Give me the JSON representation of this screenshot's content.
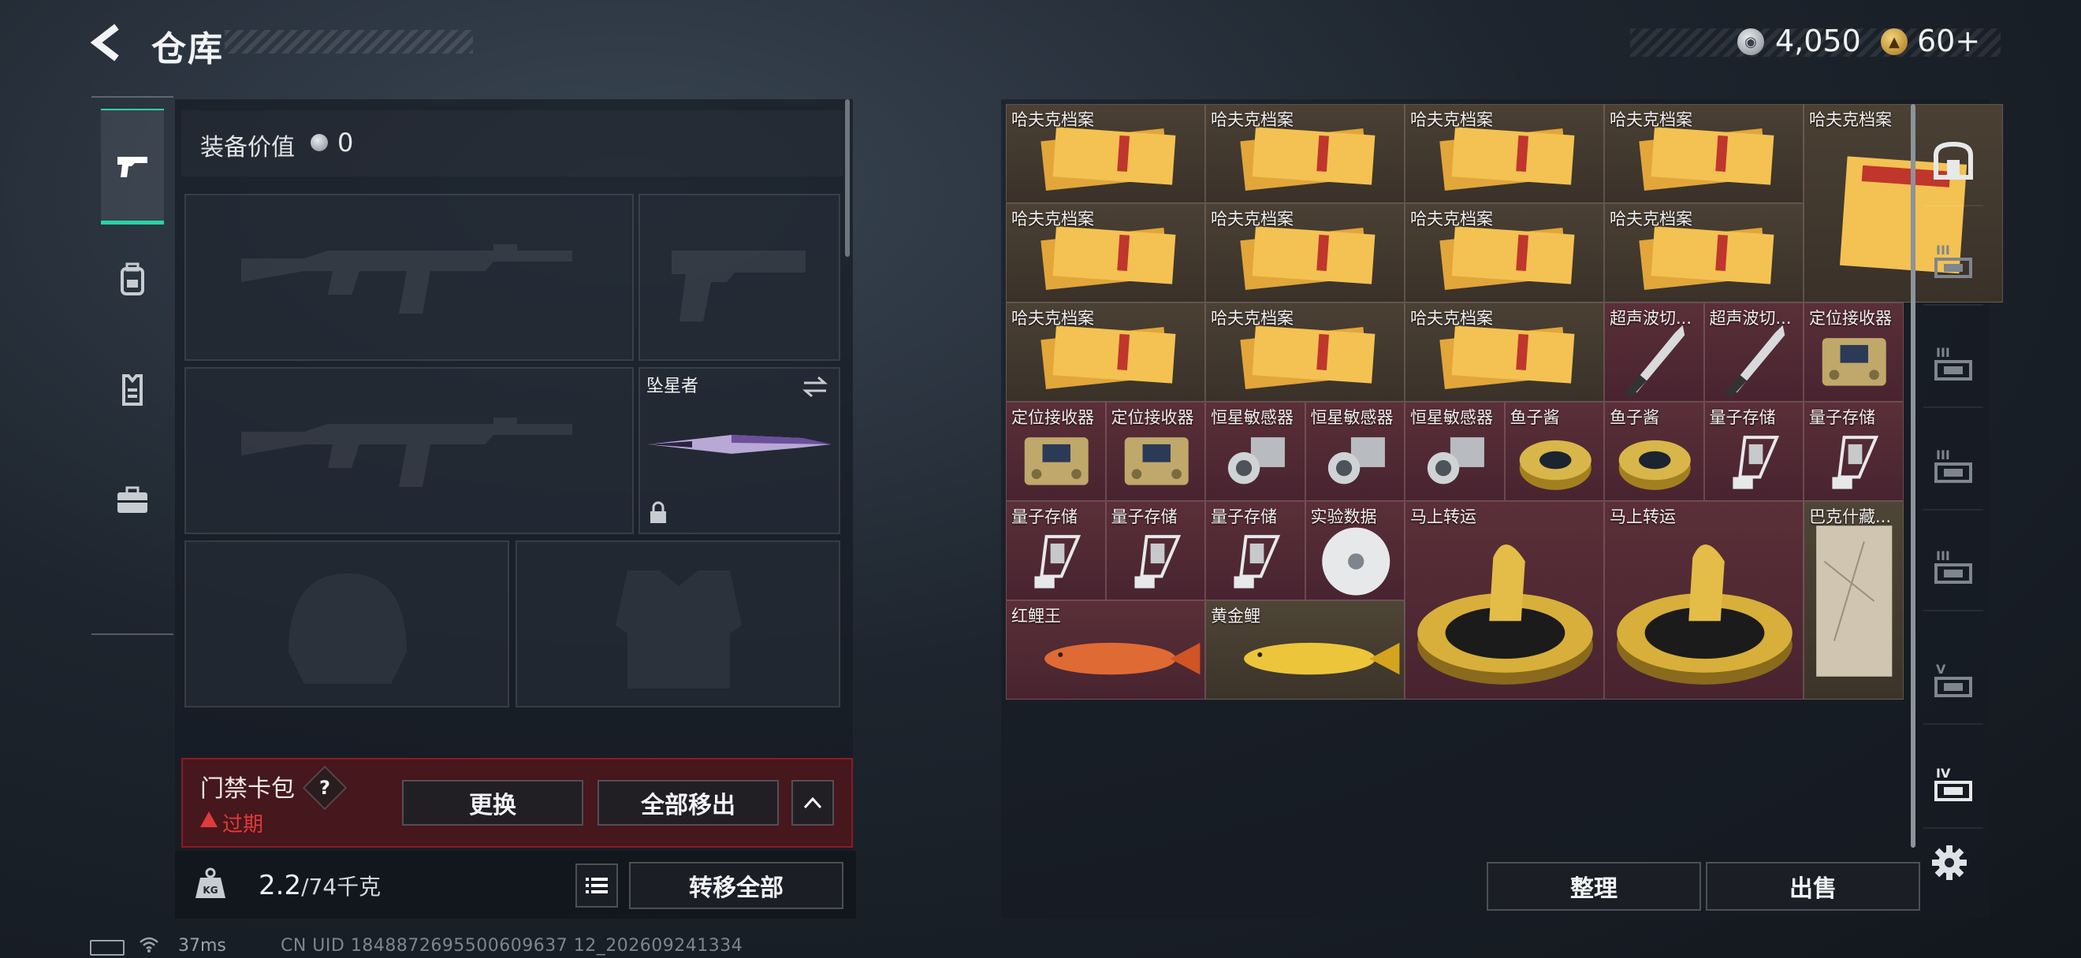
{
  "header": {
    "title": "仓库",
    "currency_silver": "4,050",
    "currency_gold": "60+"
  },
  "loadout": {
    "equip_value_label": "装备价值",
    "equip_value": "0",
    "melee_name": "坠星者"
  },
  "card_bar": {
    "title": "门禁卡包",
    "help": "?",
    "status": "过期",
    "swap_label": "更换",
    "remove_all_label": "全部移出"
  },
  "footer": {
    "weight_current": "2.2",
    "weight_capacity": "/74千克",
    "transfer_all_label": "转移全部",
    "sort_label": "整理",
    "sell_label": "出售"
  },
  "status_bar": {
    "ping": "37ms",
    "uid": "CN UID 1848872695500609637 12_202609241334"
  },
  "grid_items": [
    {
      "label": "哈夫克档案",
      "icon": "folder-icon",
      "bg": "brown"
    },
    {
      "label": "哈夫克档案",
      "icon": "folder-icon",
      "bg": "brown"
    },
    {
      "label": "哈夫克档案",
      "icon": "folder-icon",
      "bg": "brown"
    },
    {
      "label": "哈夫克档案",
      "icon": "folder-icon",
      "bg": "brown"
    },
    {
      "label": "哈夫克档案",
      "icon": "folder-tall-icon",
      "bg": "brown"
    },
    {
      "label": "哈夫克档案",
      "icon": "folder-icon",
      "bg": "brown"
    },
    {
      "label": "哈夫克档案",
      "icon": "folder-icon",
      "bg": "brown"
    },
    {
      "label": "哈夫克档案",
      "icon": "folder-icon",
      "bg": "brown"
    },
    {
      "label": "哈夫克档案",
      "icon": "folder-icon",
      "bg": "brown"
    },
    {
      "label": "哈夫克档案",
      "icon": "folder-icon",
      "bg": "brown"
    },
    {
      "label": "哈夫克档案",
      "icon": "folder-icon",
      "bg": "brown"
    },
    {
      "label": "哈夫克档案",
      "icon": "folder-icon",
      "bg": "brown"
    },
    {
      "label": "超声波切...",
      "icon": "scalpel-icon",
      "bg": "red"
    },
    {
      "label": "超声波切...",
      "icon": "scalpel-icon",
      "bg": "red"
    },
    {
      "label": "定位接收器",
      "icon": "receiver-icon",
      "bg": "red"
    },
    {
      "label": "定位接收器",
      "icon": "receiver-icon",
      "bg": "red"
    },
    {
      "label": "定位接收器",
      "icon": "receiver-icon",
      "bg": "red"
    },
    {
      "label": "恒星敏感器",
      "icon": "sensor-icon",
      "bg": "red"
    },
    {
      "label": "恒星敏感器",
      "icon": "sensor-icon",
      "bg": "red"
    },
    {
      "label": "恒星敏感器",
      "icon": "sensor-icon",
      "bg": "red"
    },
    {
      "label": "鱼子酱",
      "icon": "caviar-tin-icon",
      "bg": "red"
    },
    {
      "label": "鱼子酱",
      "icon": "caviar-tin-icon",
      "bg": "red"
    },
    {
      "label": "量子存储",
      "icon": "usb-drive-icon",
      "bg": "red"
    },
    {
      "label": "量子存储",
      "icon": "usb-drive-icon",
      "bg": "red"
    },
    {
      "label": "量子存储",
      "icon": "usb-drive-icon",
      "bg": "red"
    },
    {
      "label": "量子存储",
      "icon": "usb-drive-icon",
      "bg": "red"
    },
    {
      "label": "量子存储",
      "icon": "usb-drive-icon",
      "bg": "red"
    },
    {
      "label": "实验数据",
      "icon": "disc-icon",
      "bg": "red"
    },
    {
      "label": "马上转运",
      "icon": "horse-statue-icon",
      "bg": "red"
    },
    {
      "label": "马上转运",
      "icon": "horse-statue-icon",
      "bg": "red"
    },
    {
      "label": "巴克什藏...",
      "icon": "map-icon",
      "bg": "gold"
    },
    {
      "label": "红鲤王",
      "icon": "red-carp-icon",
      "bg": "red"
    },
    {
      "label": "黄金鲤",
      "icon": "gold-carp-icon",
      "bg": "gold"
    }
  ],
  "side_tabs": [
    {
      "icon": "vault-icon"
    },
    {
      "icon": "storage-iii-icon",
      "label": "III"
    },
    {
      "icon": "storage-iii-icon",
      "label": "III"
    },
    {
      "icon": "storage-iii-icon",
      "label": "III"
    },
    {
      "icon": "storage-iii-icon",
      "label": "III"
    },
    {
      "icon": "storage-v-icon",
      "label": "V"
    },
    {
      "icon": "storage-iv-icon",
      "label": "IV"
    }
  ],
  "colors": {
    "accent": "#27d3a8",
    "danger": "#e03a3a",
    "card_bg": "#6e1216"
  }
}
